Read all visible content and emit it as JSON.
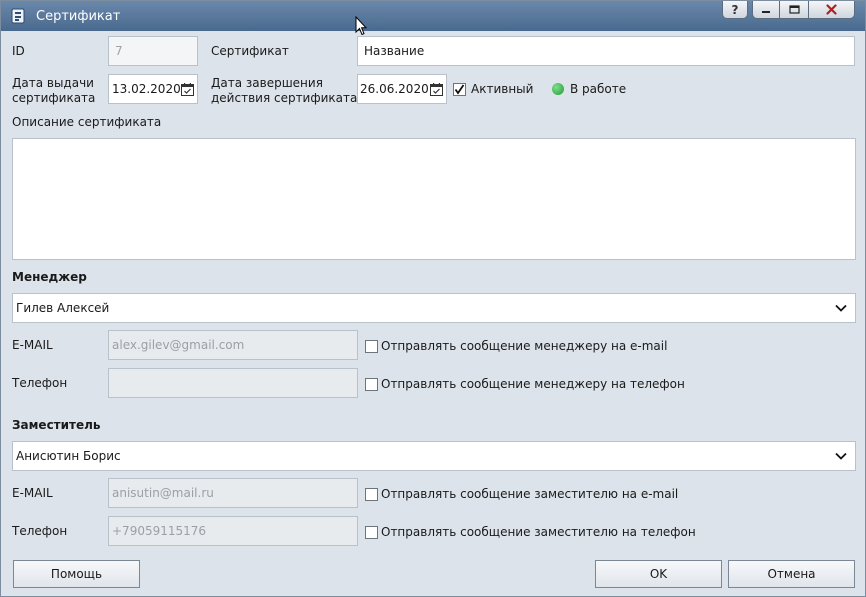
{
  "window": {
    "title": "Сертификат",
    "help_label": "?"
  },
  "form": {
    "id_label": "ID",
    "id_value": "7",
    "cert_label": "Сертификат",
    "cert_value": "Название",
    "issue_date_label_1": "Дата выдачи",
    "issue_date_label_2": "сертификата",
    "issue_date_value": "13.02.2020",
    "end_date_label_1": "Дата завершения",
    "end_date_label_2": "действия сертификата",
    "end_date_value": "26.06.2020",
    "active_label": "Активный",
    "active_checked": true,
    "status_label": "В работе",
    "status_color": "#2bb34a",
    "description_label": "Описание сертификата",
    "description_value": ""
  },
  "manager": {
    "section_label": "Менеджер",
    "selected": "Гилев Алексей",
    "email_label": "E-MAIL",
    "email_value": "alex.gilev@gmail.com",
    "email_notify_label": "Отправлять сообщение менеджеру на e-mail",
    "phone_label": "Телефон",
    "phone_value": "",
    "phone_notify_label": "Отправлять сообщение менеджеру на телефон"
  },
  "deputy": {
    "section_label": "Заместитель",
    "selected": "Анисютин Борис",
    "email_label": "E-MAIL",
    "email_value": "anisutin@mail.ru",
    "email_notify_label": "Отправлять сообщение заместителю на e-mail",
    "phone_label": "Телефон",
    "phone_value": "+79059115176",
    "phone_notify_label": "Отправлять сообщение заместителю на телефон"
  },
  "footer": {
    "help_button": "Помощь",
    "ok_button": "OK",
    "cancel_button": "Отмена"
  },
  "colors": {
    "titlebar": "#5677a0",
    "window_bg": "#dde3ea",
    "close_icon": "#b02020"
  }
}
